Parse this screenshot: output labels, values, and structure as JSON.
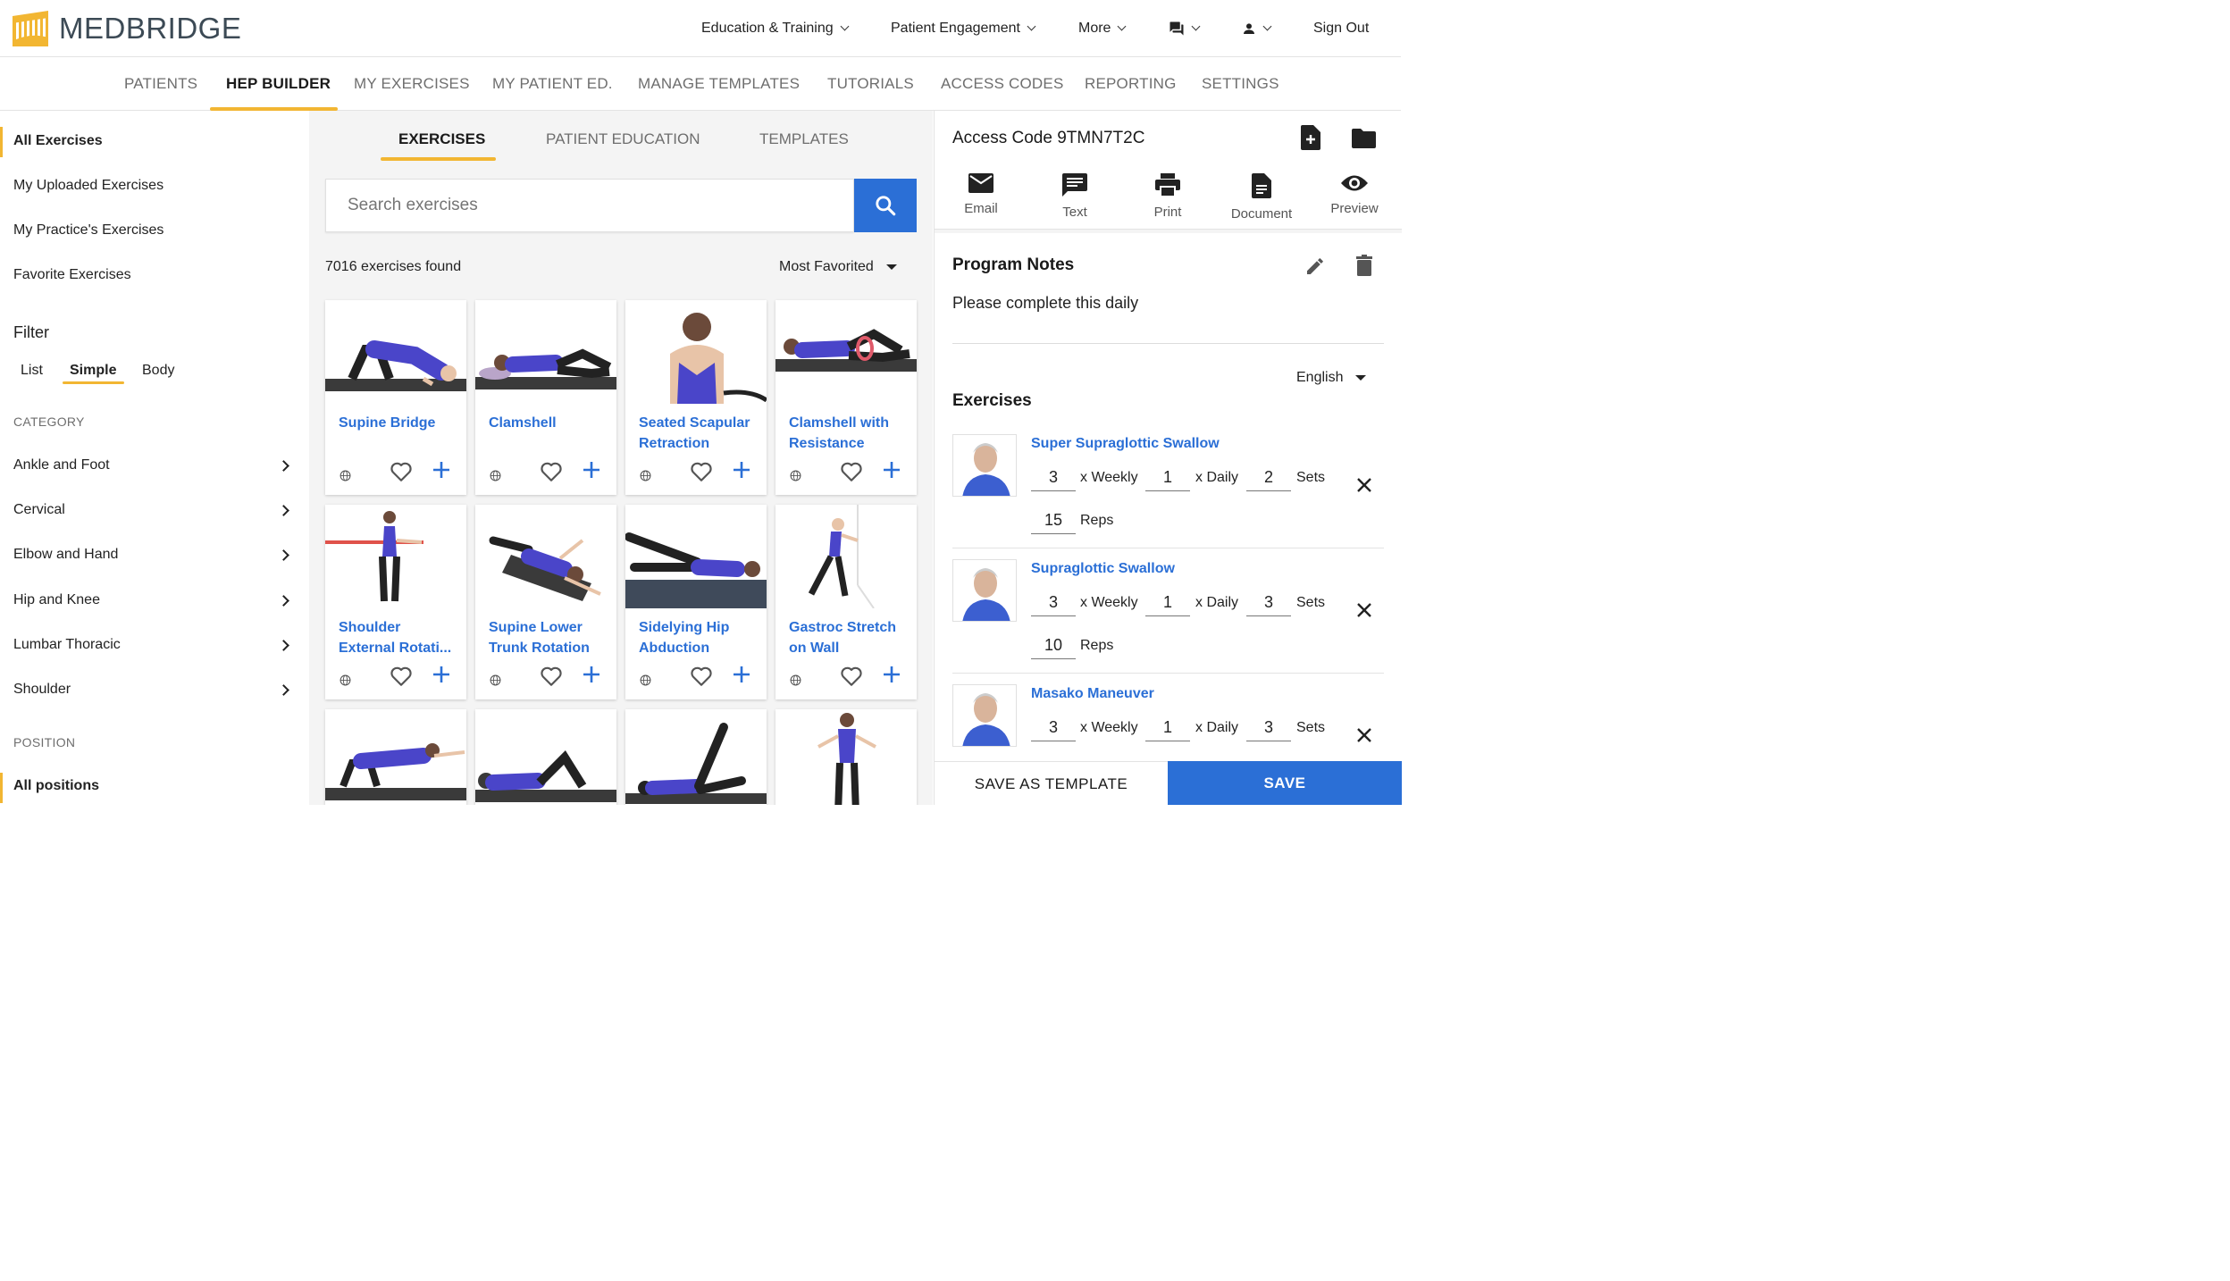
{
  "brand": {
    "name": "MEDBRIDGE",
    "accent": "#f2b632",
    "primary": "#2b6fd6"
  },
  "topnav": {
    "education": "Education & Training",
    "engagement": "Patient Engagement",
    "more": "More",
    "signout": "Sign Out"
  },
  "subnav": [
    {
      "label": "PATIENTS"
    },
    {
      "label": "HEP BUILDER"
    },
    {
      "label": "MY EXERCISES"
    },
    {
      "label": "MY PATIENT ED."
    },
    {
      "label": "MANAGE TEMPLATES"
    },
    {
      "label": "TUTORIALS"
    },
    {
      "label": "ACCESS CODES"
    },
    {
      "label": "REPORTING"
    },
    {
      "label": "SETTINGS"
    }
  ],
  "sidebar": {
    "libraries": [
      {
        "label": "All Exercises"
      },
      {
        "label": "My Uploaded Exercises"
      },
      {
        "label": "My Practice's Exercises"
      },
      {
        "label": "Favorite Exercises"
      }
    ],
    "filter_title": "Filter",
    "filter_modes": [
      {
        "label": "List"
      },
      {
        "label": "Simple"
      },
      {
        "label": "Body"
      }
    ],
    "category_title": "CATEGORY",
    "categories": [
      {
        "label": "Ankle and Foot"
      },
      {
        "label": "Cervical"
      },
      {
        "label": "Elbow and Hand"
      },
      {
        "label": "Hip and Knee"
      },
      {
        "label": "Lumbar Thoracic"
      },
      {
        "label": "Shoulder"
      }
    ],
    "position_title": "POSITION",
    "position_selected": "All positions"
  },
  "middle": {
    "tabs": [
      {
        "label": "EXERCISES"
      },
      {
        "label": "PATIENT EDUCATION"
      },
      {
        "label": "TEMPLATES"
      }
    ],
    "search_placeholder": "Search exercises",
    "found": "7016 exercises found",
    "sort": "Most Favorited",
    "cards": [
      {
        "line1": "Supine Bridge",
        "line2": ""
      },
      {
        "line1": "Clamshell",
        "line2": ""
      },
      {
        "line1": "Seated Scapular",
        "line2": "Retraction"
      },
      {
        "line1": "Clamshell with",
        "line2": "Resistance"
      },
      {
        "line1": "Shoulder",
        "line2": "External Rotati..."
      },
      {
        "line1": "Supine Lower",
        "line2": "Trunk Rotation"
      },
      {
        "line1": "Sidelying Hip",
        "line2": "Abduction"
      },
      {
        "line1": "Gastroc Stretch",
        "line2": "on Wall"
      }
    ]
  },
  "right": {
    "access_label": "Access Code",
    "access_code": "9TMN7T2C",
    "actions": [
      {
        "label": "Email"
      },
      {
        "label": "Text"
      },
      {
        "label": "Print"
      },
      {
        "label": "Document"
      },
      {
        "label": "Preview"
      }
    ],
    "notes_title": "Program Notes",
    "notes_text": "Please complete this daily",
    "language": "English",
    "exercises_title": "Exercises",
    "weekly_label": "x Weekly",
    "daily_label": "x Daily",
    "sets_label": "Sets",
    "reps_label": "Reps",
    "exercises": [
      {
        "name": "Super Supraglottic Swallow",
        "weekly": "3",
        "daily": "1",
        "sets": "2",
        "reps": "15"
      },
      {
        "name": "Supraglottic Swallow",
        "weekly": "3",
        "daily": "1",
        "sets": "3",
        "reps": "10"
      },
      {
        "name": "Masako Maneuver",
        "weekly": "3",
        "daily": "1",
        "sets": "3"
      }
    ],
    "save_template": "SAVE AS TEMPLATE",
    "save": "SAVE"
  }
}
